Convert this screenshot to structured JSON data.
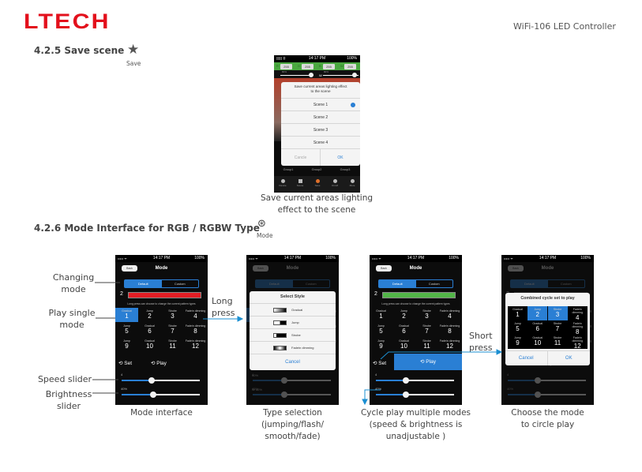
{
  "header": {
    "logo": "LTECH",
    "doc_title": "WiFi-106 LED Controller"
  },
  "section_save": {
    "title": "4.2.5 Save scene",
    "icon": "star-icon",
    "icon_label": "Save",
    "caption_line1": "Save current areas lighting",
    "caption_line2": "effect to the scene",
    "phone": {
      "status_time": "14:17 PM",
      "status_battery": "100%",
      "channels": [
        {
          "label": "R",
          "value": "255"
        },
        {
          "label": "G",
          "value": "255"
        },
        {
          "label": "B",
          "value": "255"
        },
        {
          "label": "W",
          "value": "255"
        }
      ],
      "slider_left": "80%",
      "slider_right_label": "W",
      "slider_right": "80%",
      "dialog_title": "Save current areas lighting effect to the scene",
      "scenes": [
        "Scene 1",
        "Scene 2",
        "Scene 3",
        "Scene 4"
      ],
      "selected_scene": "Scene 1",
      "cancel": "Cancle",
      "ok": "OK",
      "groups": [
        "Group1",
        "Group2",
        "Group3"
      ],
      "tabs": [
        "Device",
        "Scene",
        "Save",
        "On/off",
        "More"
      ],
      "active_tab": "Save"
    }
  },
  "section_mode": {
    "title": "4.2.6 Mode Interface for RGB / RGBW Type",
    "icon": "mode-icon",
    "icon_label": "Mode"
  },
  "common": {
    "status_signal": "••••• ᯤ",
    "status_time": "14:17 PM",
    "status_battery": "100%",
    "back": "Back",
    "nav_title": "Mode",
    "seg_default": "Default",
    "seg_custom": "Custom",
    "current_num": "2",
    "hint": "Long press can choose to change the current pattern types",
    "set": "⟲ Set",
    "play": "⟲ Play",
    "speed": "4",
    "brightness": "40%",
    "modes": [
      {
        "type": "Gradual",
        "num": "1"
      },
      {
        "type": "Jump",
        "num": "2"
      },
      {
        "type": "Strobe",
        "num": "3"
      },
      {
        "type": "Fadein dimming",
        "num": "4"
      },
      {
        "type": "Jump",
        "num": "5"
      },
      {
        "type": "Gradual",
        "num": "6"
      },
      {
        "type": "Strobe",
        "num": "7"
      },
      {
        "type": "Fadein dimming",
        "num": "8"
      },
      {
        "type": "Jump",
        "num": "9"
      },
      {
        "type": "Gradual",
        "num": "10"
      },
      {
        "type": "Strobe",
        "num": "11"
      },
      {
        "type": "Fadein dimming",
        "num": "12"
      }
    ]
  },
  "phones": [
    {
      "bar_color": "#e21d24",
      "selected": [
        0
      ],
      "play_active": false,
      "speed_level": 0.38,
      "brightness_level": 0.4,
      "caption": [
        "Mode interface"
      ]
    },
    {
      "bar_color": "#e21d24",
      "selected": [
        0
      ],
      "play_active": false,
      "speed_level": 0.4,
      "brightness_level": 0.4,
      "dim": true,
      "under_labels": [
        "40%",
        "W 40%"
      ],
      "modal": {
        "kind": "style",
        "title": "Select Style",
        "options": [
          "Gradual",
          "Jump",
          "Strobe",
          "Fadein dimming"
        ],
        "cancel": "Cancel"
      },
      "caption": [
        "Type selection",
        "(jumping/flash/",
        "smooth/fade)"
      ]
    },
    {
      "bar_color": "#52b548",
      "selected": [],
      "play_active": true,
      "speed_level": 0.38,
      "brightness_level": 0.38,
      "caption": [
        "Cycle play multiple modes",
        "(speed & brightness is",
        "unadjustable )"
      ]
    },
    {
      "bar_color": "#52b548",
      "selected": [],
      "play_active": false,
      "speed_level": 0.38,
      "brightness_level": 0.38,
      "dim": true,
      "modal": {
        "kind": "cycle",
        "title": "Combined cycle set to play",
        "selected": [
          1,
          2
        ],
        "cancel": "Cancel",
        "ok": "OK"
      },
      "caption": [
        "Choose the mode",
        "to circle play"
      ]
    }
  ],
  "annotations": {
    "changing_mode": [
      "Changing",
      "mode"
    ],
    "play_single": [
      "Play single",
      "mode"
    ],
    "speed_slider": "Speed slider",
    "brightness_slider": [
      "Brightness",
      "slider"
    ],
    "long_press": [
      "Long",
      "press"
    ],
    "short_press": [
      "Short",
      "press"
    ]
  },
  "colors": {
    "brand": "#e3101c",
    "accent": "#2a7fd4",
    "annotation_line": "#1b8fd2"
  }
}
